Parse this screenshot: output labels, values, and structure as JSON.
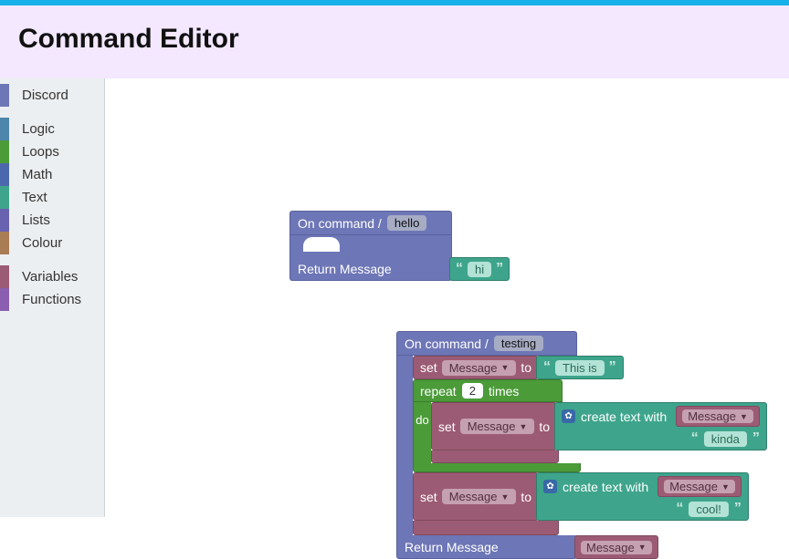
{
  "header": {
    "title": "Command Editor"
  },
  "sidebar": {
    "categories": [
      {
        "key": "discord",
        "label": "Discord",
        "color": "#6d76b6"
      },
      {
        "key": "logic",
        "label": "Logic",
        "color": "#4d86ab"
      },
      {
        "key": "loops",
        "label": "Loops",
        "color": "#4b9b39"
      },
      {
        "key": "math",
        "label": "Math",
        "color": "#4c68ad"
      },
      {
        "key": "text",
        "label": "Text",
        "color": "#3ea58c"
      },
      {
        "key": "lists",
        "label": "Lists",
        "color": "#6962b0"
      },
      {
        "key": "colour",
        "label": "Colour",
        "color": "#a97c54"
      },
      {
        "key": "variables",
        "label": "Variables",
        "color": "#9c5b74"
      },
      {
        "key": "functions",
        "label": "Functions",
        "color": "#8b5fb0"
      }
    ]
  },
  "blocks": {
    "b1": {
      "head_prefix": "On command /",
      "command_name": "hello",
      "return_label": "Return Message",
      "return_text": "hi"
    },
    "b2": {
      "head_prefix": "On command /",
      "command_name": "testing",
      "set1": {
        "set_label": "set",
        "var_label": "Message",
        "to_label": "to",
        "text": "This is "
      },
      "repeat": {
        "repeat_label": "repeat",
        "count": "2",
        "times_label": "times",
        "do_label": "do"
      },
      "inner_set": {
        "set_label": "set",
        "var_label": "Message",
        "to_label": "to",
        "create_label": "create text with",
        "arg1_var": "Message",
        "arg2_text": "kinda "
      },
      "set2": {
        "set_label": "set",
        "var_label": "Message",
        "to_label": "to",
        "create_label": "create text with",
        "arg1_var": "Message",
        "arg2_text": "cool!"
      },
      "return_label": "Return Message",
      "return_var": "Message"
    }
  }
}
